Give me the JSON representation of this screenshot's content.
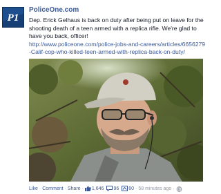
{
  "page": {
    "name": "PoliceOne.com",
    "logo_text": "P1"
  },
  "post": {
    "message": "Dep. Erick Gelhaus is back on duty after being put on leave for the shooting death of a teen armed with a replica rifle. We're glad to have you back, officer!",
    "link": "http://www.policeone.com/police-jobs-and-careers/articles/6656279-Calif-cop-who-killed-teen-armed-with-replica-back-on-duty/"
  },
  "actions": {
    "like": "Like",
    "comment": "Comment",
    "share": "Share",
    "likes_count": "1,646",
    "comments_count": "96",
    "shares_count": "60",
    "time": "58 minutes ago"
  },
  "icons": [
    "like-thumb-icon",
    "comment-bubble-icon",
    "share-icon",
    "globe-icon"
  ],
  "colors": {
    "link": "#3b5998",
    "logo_bg": "#1d4f8f",
    "meta": "#9197a3"
  }
}
